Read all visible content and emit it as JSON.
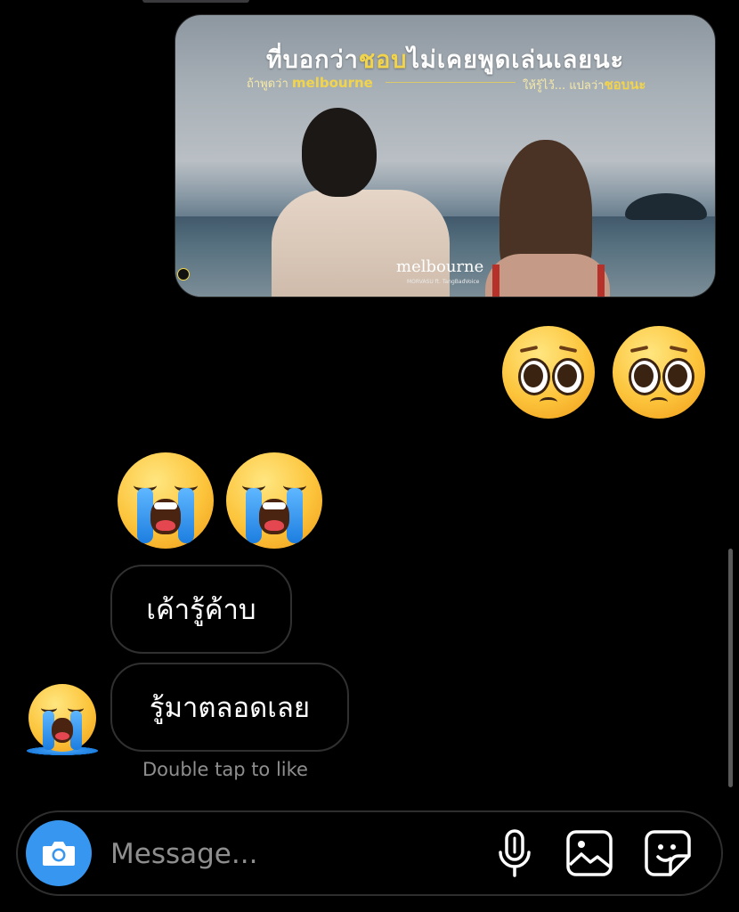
{
  "post": {
    "title_a": "ที่บอกว่า",
    "title_hl": "ชอบ",
    "title_b": "ไม่เคยพูดเล่นเลยนะ",
    "sub_left_a": "ถ้าพูดว่า ",
    "sub_left_b": "melbourne",
    "sub_right_a": "ให้รู้ไว้... แปลว่า",
    "sub_right_b": "ชอบนะ",
    "logo": "melbourne",
    "credit": "MORVASU ft. TangBadVoice"
  },
  "reactions_sent": {
    "emoji_1": "pleading-face",
    "emoji_2": "pleading-face"
  },
  "reactions_received": {
    "emoji_1": "loudly-crying-face",
    "emoji_2": "loudly-crying-face"
  },
  "messages": [
    {
      "text": "เค้ารู้ค้าบ"
    },
    {
      "text": "รู้มาตลอดเลย"
    }
  ],
  "hint": "Double tap to like",
  "composer": {
    "placeholder": "Message...",
    "icons": [
      "camera-icon",
      "microphone-icon",
      "gallery-icon",
      "sticker-icon"
    ]
  },
  "colors": {
    "background": "#000000",
    "bubble_border": "#303030",
    "camera_button": "#3797f0",
    "hint_text": "#8e8e8e",
    "post_highlight": "#f2d44c"
  }
}
